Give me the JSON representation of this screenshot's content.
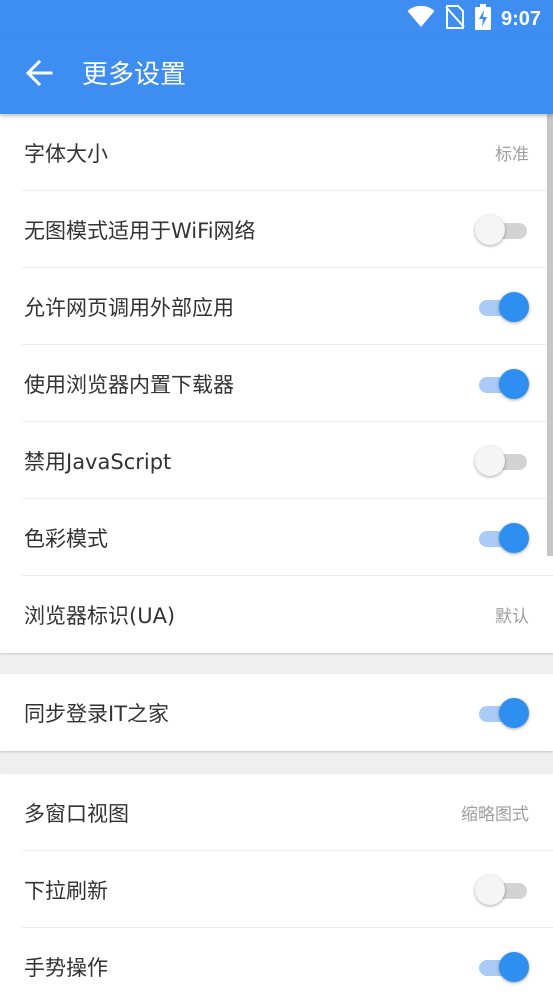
{
  "status_bar": {
    "time": "9:07",
    "icons": [
      "wifi-icon",
      "no-sim-icon",
      "battery-charging-icon"
    ]
  },
  "app_bar": {
    "back_icon": "arrow-left-icon",
    "title": "更多设置"
  },
  "colors": {
    "primary": "#3d8ef0",
    "toggle_on_knob": "#2f8ff0",
    "toggle_on_track": "#a9cbf5",
    "toggle_off_track": "#d3d3d3",
    "value_text": "#9e9e9e"
  },
  "groups": [
    {
      "items": [
        {
          "label": "字体大小",
          "value": "标准"
        },
        {
          "label": "无图模式适用于WiFi网络",
          "toggle": false
        },
        {
          "label": "允许网页调用外部应用",
          "toggle": true
        },
        {
          "label": "使用浏览器内置下载器",
          "toggle": true
        },
        {
          "label": "禁用JavaScript",
          "toggle": false
        },
        {
          "label": "色彩模式",
          "toggle": true
        },
        {
          "label": "浏览器标识(UA)",
          "value": "默认"
        }
      ]
    },
    {
      "items": [
        {
          "label": "同步登录IT之家",
          "toggle": true
        }
      ]
    },
    {
      "items": [
        {
          "label": "多窗口视图",
          "value": "缩略图式"
        },
        {
          "label": "下拉刷新",
          "toggle": false
        },
        {
          "label": "手势操作",
          "toggle": true
        }
      ]
    }
  ]
}
